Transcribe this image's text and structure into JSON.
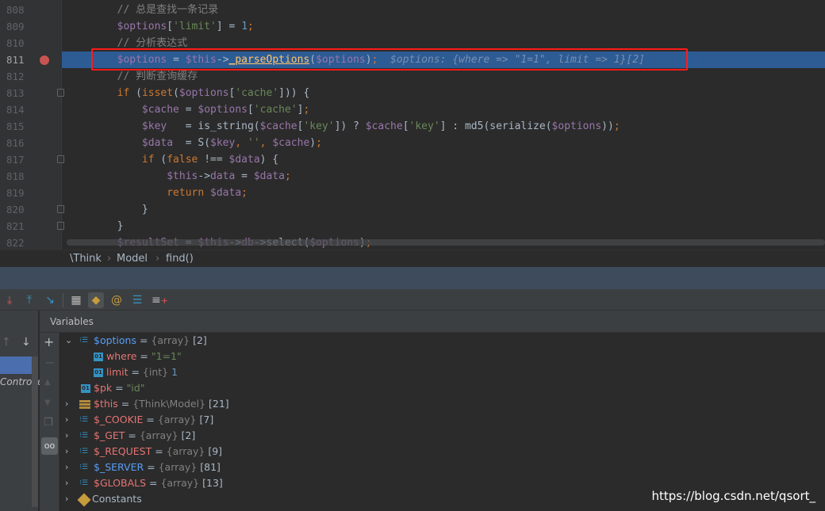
{
  "editor": {
    "current_line": "811",
    "lines": [
      {
        "num": "808",
        "tokens": [
          [
            "pl",
            "        "
          ],
          [
            "cm",
            "// 总是查找一条记录"
          ]
        ]
      },
      {
        "num": "809",
        "tokens": [
          [
            "pl",
            "        "
          ],
          [
            "var",
            "$options"
          ],
          [
            "pl",
            "["
          ],
          [
            "str",
            "'limit'"
          ],
          [
            "pl",
            "] = "
          ],
          [
            "num",
            "1"
          ],
          [
            "kw",
            ";"
          ]
        ]
      },
      {
        "num": "810",
        "tokens": [
          [
            "pl",
            "        "
          ],
          [
            "cm",
            "// 分析表达式"
          ]
        ]
      },
      {
        "num": "811",
        "tokens": [
          [
            "pl",
            "        "
          ],
          [
            "var",
            "$options"
          ],
          [
            "pl",
            " = "
          ],
          [
            "var",
            "$this"
          ],
          [
            "pl",
            "->"
          ],
          [
            "fn",
            "_parseOptions"
          ],
          [
            "pl",
            "("
          ],
          [
            "var",
            "$options"
          ],
          [
            "pl",
            ")"
          ],
          [
            "kw",
            ";"
          ],
          [
            "pl",
            "  "
          ],
          [
            "inl",
            "$options: {where => \"1=1\", limit => 1}[2]"
          ]
        ]
      },
      {
        "num": "812",
        "tokens": [
          [
            "pl",
            "        "
          ],
          [
            "cm",
            "// 判断查询缓存"
          ]
        ]
      },
      {
        "num": "813",
        "tokens": [
          [
            "pl",
            "        "
          ],
          [
            "kw",
            "if "
          ],
          [
            "pl",
            "("
          ],
          [
            "kw",
            "isset"
          ],
          [
            "pl",
            "("
          ],
          [
            "var",
            "$options"
          ],
          [
            "pl",
            "["
          ],
          [
            "str",
            "'cache'"
          ],
          [
            "pl",
            "])) {"
          ]
        ]
      },
      {
        "num": "814",
        "tokens": [
          [
            "pl",
            "            "
          ],
          [
            "var",
            "$cache"
          ],
          [
            "pl",
            " = "
          ],
          [
            "var",
            "$options"
          ],
          [
            "pl",
            "["
          ],
          [
            "str",
            "'cache'"
          ],
          [
            "pl",
            "]"
          ],
          [
            "kw",
            ";"
          ]
        ]
      },
      {
        "num": "815",
        "tokens": [
          [
            "pl",
            "            "
          ],
          [
            "var",
            "$key"
          ],
          [
            "pl",
            "   = is_string("
          ],
          [
            "var",
            "$cache"
          ],
          [
            "pl",
            "["
          ],
          [
            "str",
            "'key'"
          ],
          [
            "pl",
            "]) ? "
          ],
          [
            "var",
            "$cache"
          ],
          [
            "pl",
            "["
          ],
          [
            "str",
            "'key'"
          ],
          [
            "pl",
            "] : md5(serialize("
          ],
          [
            "var",
            "$options"
          ],
          [
            "pl",
            "))"
          ],
          [
            "kw",
            ";"
          ]
        ]
      },
      {
        "num": "816",
        "tokens": [
          [
            "pl",
            "            "
          ],
          [
            "var",
            "$data"
          ],
          [
            "pl",
            "  = S("
          ],
          [
            "var",
            "$key"
          ],
          [
            "kw",
            ", "
          ],
          [
            "str",
            "''"
          ],
          [
            "kw",
            ", "
          ],
          [
            "var",
            "$cache"
          ],
          [
            "pl",
            ")"
          ],
          [
            "kw",
            ";"
          ]
        ]
      },
      {
        "num": "817",
        "tokens": [
          [
            "pl",
            "            "
          ],
          [
            "kw",
            "if "
          ],
          [
            "pl",
            "("
          ],
          [
            "kw",
            "false "
          ],
          [
            "pl",
            "!== "
          ],
          [
            "var",
            "$data"
          ],
          [
            "pl",
            ") {"
          ]
        ]
      },
      {
        "num": "818",
        "tokens": [
          [
            "pl",
            "                "
          ],
          [
            "var",
            "$this"
          ],
          [
            "pl",
            "->"
          ],
          [
            "var",
            "data"
          ],
          [
            "pl",
            " = "
          ],
          [
            "var",
            "$data"
          ],
          [
            "kw",
            ";"
          ]
        ]
      },
      {
        "num": "819",
        "tokens": [
          [
            "pl",
            "                "
          ],
          [
            "kw",
            "return "
          ],
          [
            "var",
            "$data"
          ],
          [
            "kw",
            ";"
          ]
        ]
      },
      {
        "num": "820",
        "tokens": [
          [
            "pl",
            "            }"
          ]
        ]
      },
      {
        "num": "821",
        "tokens": [
          [
            "pl",
            "        }"
          ]
        ]
      },
      {
        "num": "822",
        "tokens": [
          [
            "pl",
            "        "
          ],
          [
            "var",
            "$resultSet"
          ],
          [
            "pl",
            " = "
          ],
          [
            "var",
            "$this"
          ],
          [
            "pl",
            "->"
          ],
          [
            "var",
            "db"
          ],
          [
            "pl",
            "->select("
          ],
          [
            "var",
            "$options"
          ],
          [
            "pl",
            ")"
          ],
          [
            "kw",
            ";"
          ]
        ]
      }
    ]
  },
  "breadcrumb": [
    "\\Think",
    "Model",
    "find()"
  ],
  "debugger": {
    "panel_title": "Variables",
    "frame_partial": "Controlle",
    "variables": [
      {
        "name": "$options",
        "type": "{array}",
        "value": "[2]",
        "icon": "array-icon",
        "expanded": true,
        "modified": true,
        "level": 0
      },
      {
        "name": "where",
        "value_str": "\"1=1\"",
        "icon": "field-icon",
        "level": 1
      },
      {
        "name": "limit",
        "type": "{int}",
        "value_num": "1",
        "icon": "field-icon",
        "level": 1
      },
      {
        "name": "$pk",
        "value_str": "\"id\"",
        "icon": "field-icon",
        "level": 0,
        "leaf": true
      },
      {
        "name": "$this",
        "type": "{Think\\Model}",
        "value": "[21]",
        "icon": "object-icon",
        "level": 0
      },
      {
        "name": "$_COOKIE",
        "type": "{array}",
        "value": "[7]",
        "icon": "array-icon",
        "level": 0
      },
      {
        "name": "$_GET",
        "type": "{array}",
        "value": "[2]",
        "icon": "array-icon",
        "level": 0
      },
      {
        "name": "$_REQUEST",
        "type": "{array}",
        "value": "[9]",
        "icon": "array-icon",
        "level": 0
      },
      {
        "name": "$_SERVER",
        "type": "{array}",
        "value": "[81]",
        "icon": "array-icon",
        "modified": true,
        "level": 0
      },
      {
        "name": "$GLOBALS",
        "type": "{array}",
        "value": "[13]",
        "icon": "array-icon",
        "level": 0
      },
      {
        "name": "Constants",
        "icon": "constants-icon",
        "level": 0,
        "plain": true
      }
    ]
  },
  "watermark": "https://blog.csdn.net/qsort_",
  "colors": {
    "highlight": "#2d5b94",
    "breakpoint": "#c75450",
    "annotation_box": "#ff1a1a"
  }
}
